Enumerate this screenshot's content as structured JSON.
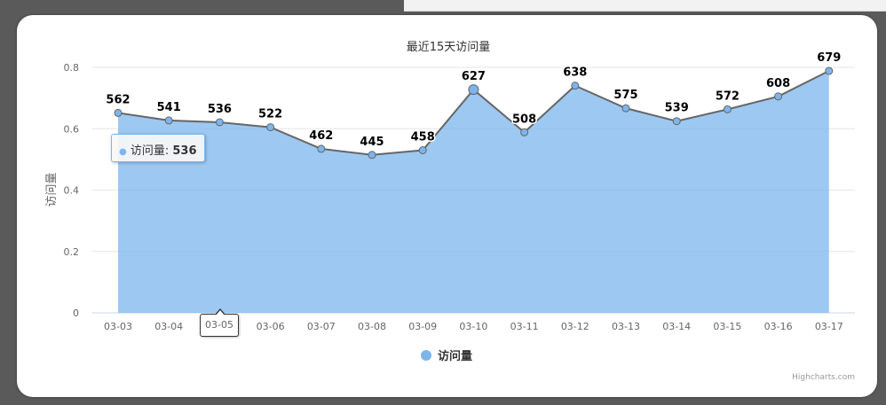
{
  "chart_data": {
    "type": "area",
    "title": "最近15天访问量",
    "xlabel": "",
    "ylabel": "访问量",
    "categories": [
      "03-03",
      "03-04",
      "03-05",
      "03-06",
      "03-07",
      "03-08",
      "03-09",
      "03-10",
      "03-11",
      "03-12",
      "03-13",
      "03-14",
      "03-15",
      "03-16",
      "03-17"
    ],
    "series": [
      {
        "name": "访问量",
        "values": [
          562,
          541,
          536,
          522,
          462,
          445,
          458,
          627,
          508,
          638,
          575,
          539,
          572,
          608,
          679
        ]
      }
    ],
    "y_axis_ticks": [
      "0",
      "0.2",
      "0.4",
      "0.6",
      "0.8"
    ],
    "grid": true,
    "legend": "bottom-center",
    "colors": {
      "fill": "#7cb5ec",
      "line": "#666666",
      "marker": "#7cb5ec"
    }
  },
  "tooltip": {
    "series_label": "访问量: ",
    "value": "536",
    "category": "03-05"
  },
  "credits": "Highcharts.com"
}
